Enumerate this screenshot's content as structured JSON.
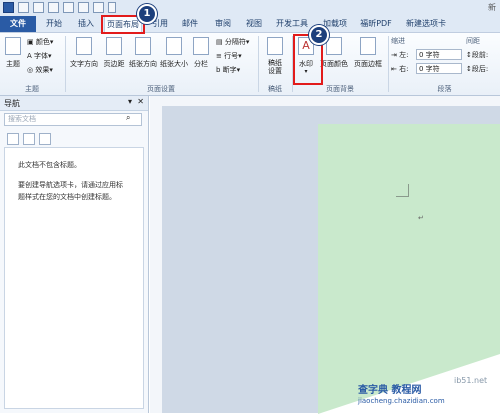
{
  "title_fragment": "新",
  "tabs": {
    "file": "文件",
    "home": "开始",
    "insert": "插入",
    "page_layout": "页面布局",
    "references": "引用",
    "mailings": "邮件",
    "review": "审阅",
    "view": "视图",
    "developer": "开发工具",
    "addins": "加载项",
    "foxit_pdf": "福昕PDF",
    "new_tab": "新建选项卡"
  },
  "ribbon": {
    "theme": {
      "themes": "主题",
      "colors": "颜色",
      "fonts": "字体",
      "effects": "效果",
      "group": "主题"
    },
    "page_setup": {
      "text_direction": "文字方向",
      "margins": "页边距",
      "orientation": "纸张方向",
      "size": "纸张大小",
      "columns": "分栏",
      "breaks": "分隔符",
      "line_numbers": "行号",
      "hyphenation": "断字",
      "group": "页面设置"
    },
    "manuscript": {
      "settings": "稿纸\n设置",
      "group": "稿纸"
    },
    "page_background": {
      "watermark": "水印",
      "page_color": "页面颜色",
      "page_borders": "页面边框",
      "group": "页面背景"
    },
    "paragraph": {
      "indent": "缩进",
      "spacing": "间距",
      "left_label": "左:",
      "right_label": "右:",
      "left_value": "0 字符",
      "right_value": "0 字符",
      "before_label": "段前:",
      "after_label": "段后:",
      "group": "段落"
    }
  },
  "nav_pane": {
    "title": "导航",
    "search_placeholder": "搜索文档",
    "message_line1": "此文档不包含标题。",
    "message_line2": "要创建导航选项卡，请通过应用标",
    "message_line3": "题样式在您的文档中创建标题。"
  },
  "callouts": {
    "one": "1",
    "two": "2"
  },
  "watermark_text": {
    "site": "查字典 教程网",
    "url": "jiaocheng.chazidian.com",
    "corner": "ib51.net"
  },
  "colors": {
    "accent": "#2a5ba5",
    "highlight": "#e21b1b",
    "page_bg": "#c9e9cc",
    "badge": "#1c3f7c"
  }
}
